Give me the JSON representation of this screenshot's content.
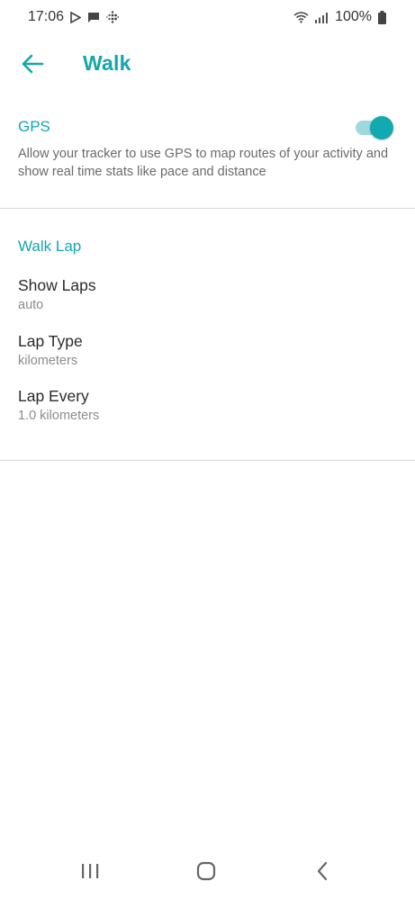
{
  "status_bar": {
    "time": "17:06",
    "battery_percent": "100%",
    "left_icons": [
      "play-store-icon",
      "message-icon",
      "fitbit-icon"
    ],
    "right_icons": [
      "wifi-icon",
      "signal-icon",
      "battery-icon"
    ]
  },
  "app_bar": {
    "title": "Walk",
    "back_icon": "arrow-left-icon"
  },
  "gps": {
    "label": "GPS",
    "enabled": true,
    "description": "Allow your tracker to use GPS to map routes of your activity and show real time stats like pace and distance"
  },
  "walk_lap": {
    "header": "Walk Lap",
    "settings": [
      {
        "title": "Show Laps",
        "value": "auto"
      },
      {
        "title": "Lap Type",
        "value": "kilometers"
      },
      {
        "title": "Lap Every",
        "value": "1.0 kilometers"
      }
    ]
  },
  "nav_bar": {
    "buttons": [
      "recent-apps-icon",
      "home-icon",
      "back-icon"
    ]
  },
  "colors": {
    "accent": "#14a6ad",
    "toggle_track": "#9fd9db",
    "divider": "#d9d9d9",
    "secondary_text": "#8c8c8c"
  }
}
